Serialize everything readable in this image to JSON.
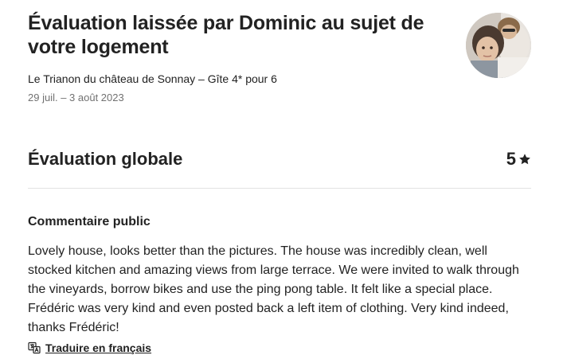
{
  "review": {
    "title": "Évaluation laissée par Dominic au sujet de votre logement",
    "listing_name": "Le Trianon du château de Sonnay – Gîte 4* pour 6",
    "dates": "29 juil. – 3 août 2023",
    "avatar_icon": "user-avatar-photo"
  },
  "overall": {
    "label": "Évaluation globale",
    "score": "5",
    "icon": "star-icon"
  },
  "public_comment": {
    "heading": "Commentaire public",
    "text": "Lovely house, looks better than the pictures. The house was incredibly clean, well stocked kitchen and amazing views from large terrace. We were invited to walk through the vineyards, borrow bikes and use the ping pong table. It felt like a special place. Frédéric was very kind and even posted back a left item of clothing. Very kind indeed, thanks Frédéric!",
    "translate_label": "Traduire en français",
    "translate_icon": "translate-icon"
  }
}
